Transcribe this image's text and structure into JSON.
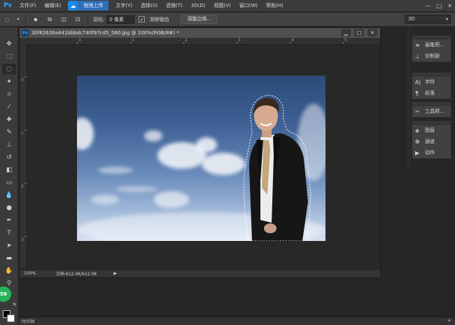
{
  "menubar": {
    "logo": "Ps",
    "items_left": [
      "文件(F)",
      "编辑(E)"
    ],
    "upload_label": "拖拽上传",
    "items_right": [
      "文字(Y)",
      "选择(S)",
      "滤镜(T)",
      "3D(D)",
      "视图(V)",
      "窗口(W)",
      "帮助(H)"
    ],
    "window_controls": [
      "—",
      "□",
      "✕"
    ]
  },
  "options_bar": {
    "feather_label": "羽化:",
    "feather_value": "0 像素",
    "antialias_label": "消除锯齿",
    "refine_edge_button": "调整边缘...",
    "workspace": "3D"
  },
  "document": {
    "title": "30f62626a441bbbdc740f97cd5_560.jpg @ 100%(RGB/8#) *",
    "zoom": "100%",
    "doc_info": "文档:612.0K/612.0K",
    "ruler_h_numbers": [
      "0",
      "1",
      "2",
      "3",
      "4",
      "5"
    ],
    "ruler_v_numbers": [
      "0",
      "1",
      "2",
      "3"
    ]
  },
  "panels": {
    "group1": [
      {
        "icon": "brush-preset-icon",
        "label": "画笔预..."
      },
      {
        "icon": "clone-source-icon",
        "label": "仿制源"
      }
    ],
    "group2": [
      {
        "icon": "character-icon",
        "label": "字符"
      },
      {
        "icon": "paragraph-icon",
        "label": "段落"
      }
    ],
    "group3": [
      {
        "icon": "tool-presets-icon",
        "label": "工具预..."
      }
    ],
    "group4": [
      {
        "icon": "layers-icon",
        "label": "图层"
      },
      {
        "icon": "channels-icon",
        "label": "通道"
      },
      {
        "icon": "actions-icon",
        "label": "动作"
      }
    ]
  },
  "bottom_bar": {
    "left_label": "时间轴",
    "right_label": "≡"
  },
  "badge": "58"
}
